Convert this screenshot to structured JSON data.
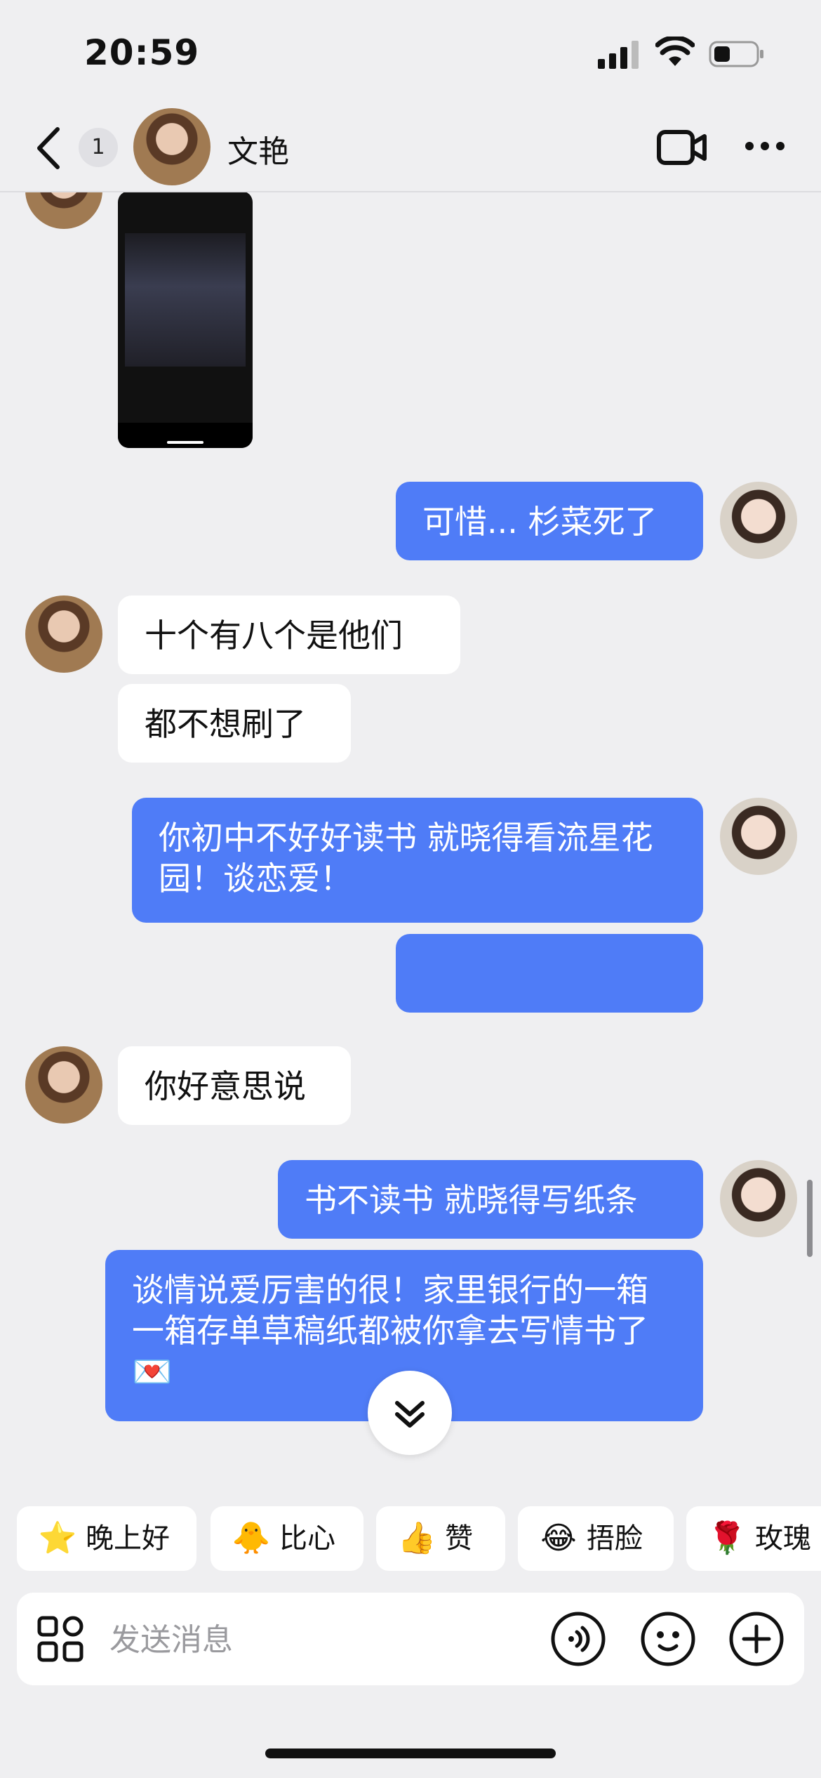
{
  "status_bar": {
    "time": "20:59"
  },
  "header": {
    "unread_count": "1",
    "contact_name": "文艳"
  },
  "messages": [
    {
      "side": "right",
      "text": "可惜... 杉菜死了"
    },
    {
      "side": "left",
      "text": "十个有八个是他们"
    },
    {
      "side": "left",
      "text": "都不想刷了"
    },
    {
      "side": "right",
      "text": "你初中不好好读书 就晓得看流星花园！谈恋爱！"
    },
    {
      "side": "right",
      "text": ""
    },
    {
      "side": "left",
      "text": "你好意思说"
    },
    {
      "side": "right",
      "text": "书不读书 就晓得写纸条"
    },
    {
      "side": "right",
      "text": "谈情说爱厉害的很！家里银行的一箱一箱存单草稿纸都被你拿去写情书了💌"
    }
  ],
  "quick_replies": [
    {
      "label": "晚上好",
      "icon": "star-face-icon",
      "emoji": "⭐"
    },
    {
      "label": "比心",
      "icon": "chick-heart-icon",
      "emoji": "🐥"
    },
    {
      "label": "赞",
      "icon": "thumbs-up-icon",
      "emoji": "👍"
    },
    {
      "label": "捂脸",
      "icon": "facepalm-icon",
      "emoji": "😂"
    },
    {
      "label": "玫瑰",
      "icon": "rose-icon",
      "emoji": "🌹"
    }
  ],
  "input": {
    "placeholder": "发送消息"
  },
  "colors": {
    "my_bubble": "#4f7cf7",
    "background": "#efeff1"
  }
}
